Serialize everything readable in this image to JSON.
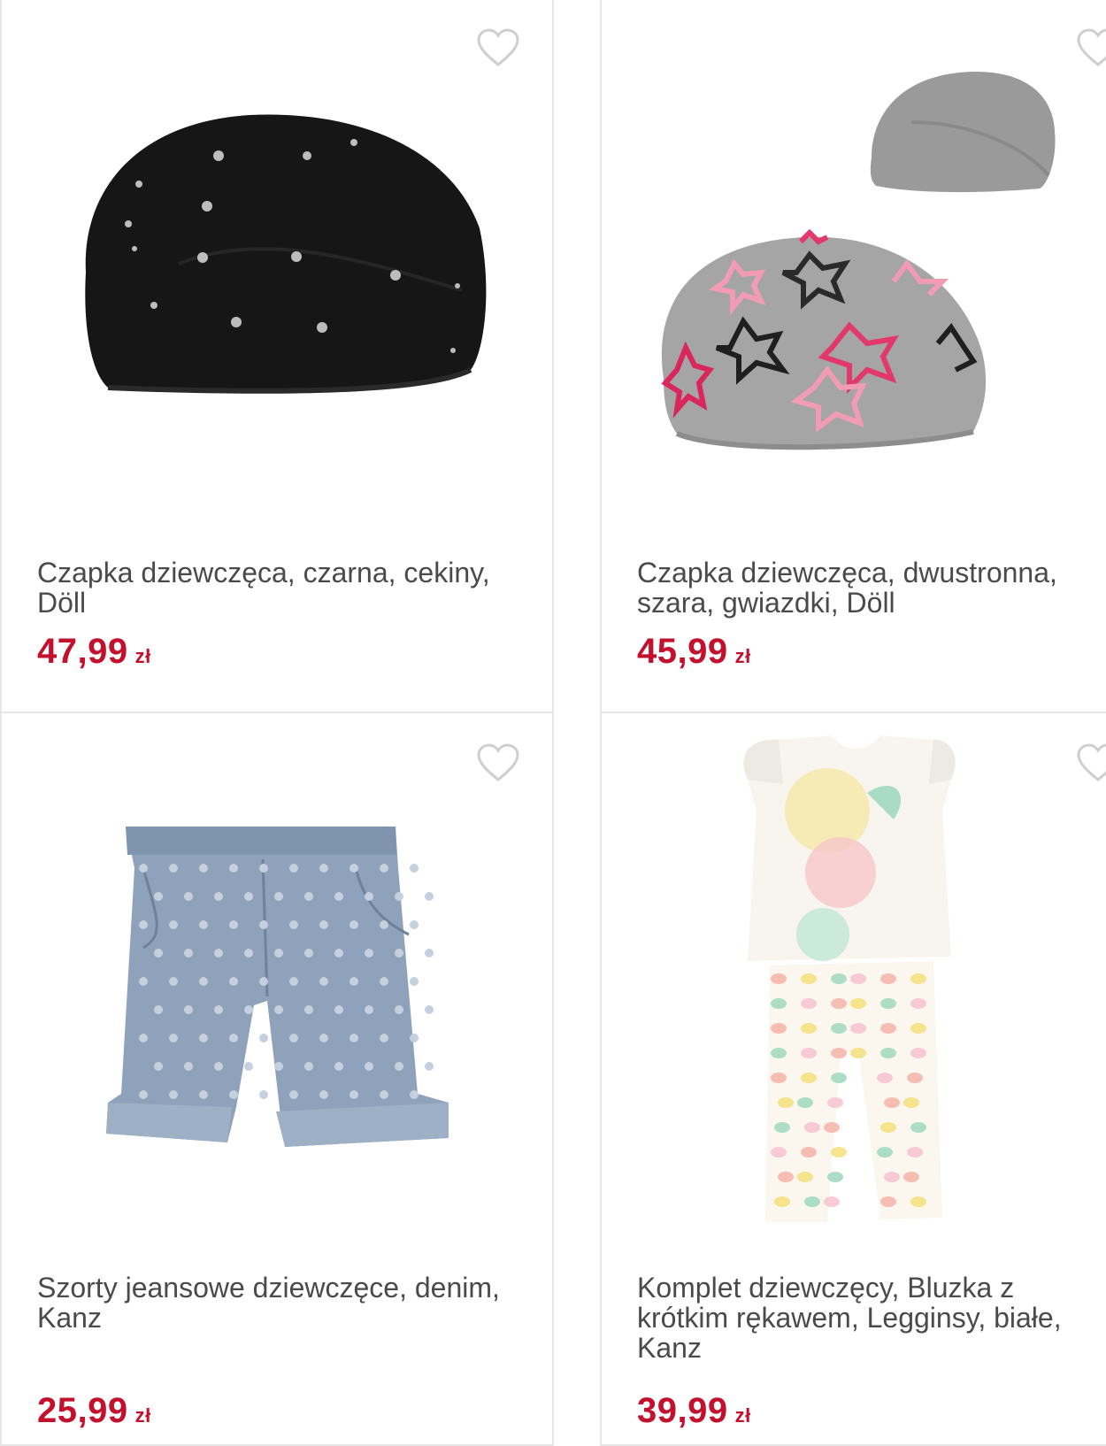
{
  "products": [
    {
      "name": "Czapka dziewczęca, czarna, cekiny, Döll",
      "price": "47,99",
      "currency": "zł"
    },
    {
      "name": "Czapka dziewczęca, dwustronna, szara, gwiazdki, Döll",
      "price": "45,99",
      "currency": "zł"
    },
    {
      "name": "Szorty jeansowe dziewczęce, denim, Kanz",
      "price": "25,99",
      "currency": "zł"
    },
    {
      "name": "Komplet dziewczęcy, Bluzka z krótkim rękawem, Legginsy, białe, Kanz",
      "price": "39,99",
      "currency": "zł"
    }
  ],
  "icons": {
    "wishlist": "heart-outline-icon"
  },
  "colors": {
    "price": "#c3102d",
    "text": "#4a4a4a",
    "border": "#e6e6e6",
    "heart": "#cfcfcf"
  }
}
